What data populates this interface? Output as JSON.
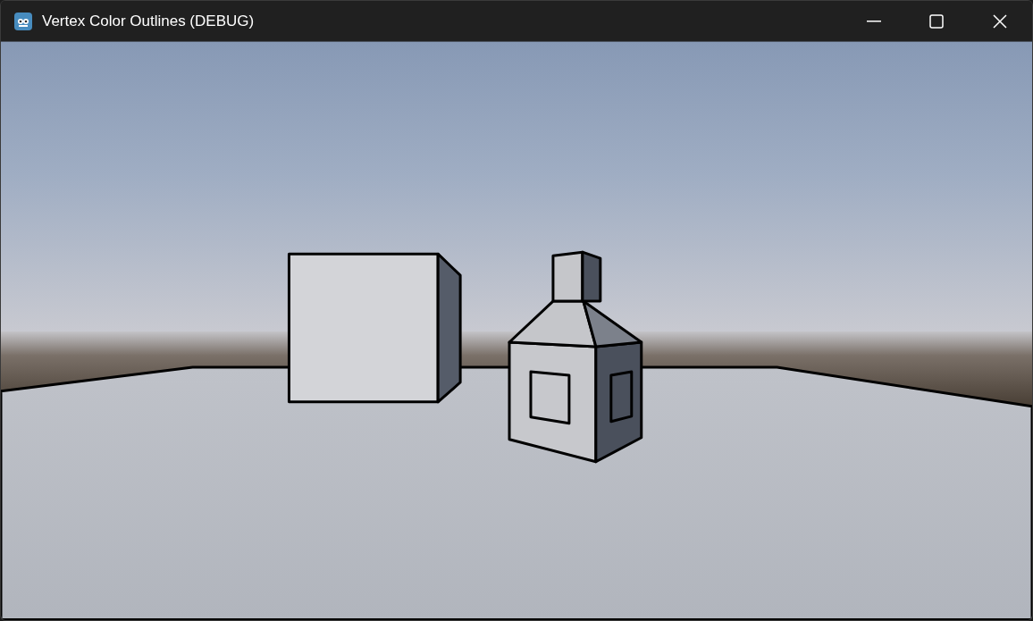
{
  "window": {
    "title": "Vertex Color Outlines (DEBUG)"
  }
}
